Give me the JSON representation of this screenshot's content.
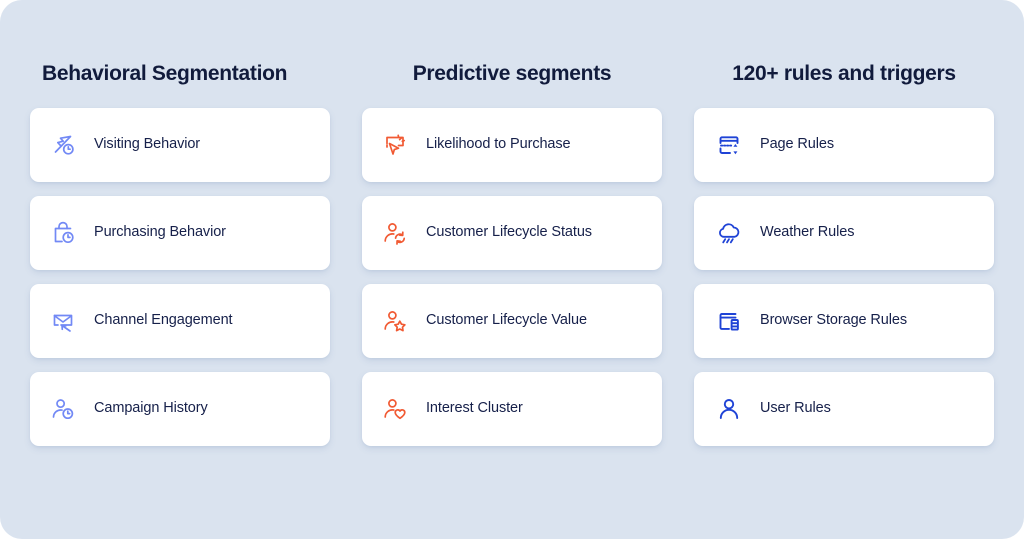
{
  "theme": {
    "background": "#dae3ef",
    "card_background": "#ffffff",
    "heading_color": "#111b3c",
    "label_color": "#16204a",
    "accent_periwinkle": "#7289f5",
    "accent_orange": "#f15a33",
    "accent_blue": "#1f43d6"
  },
  "columns": [
    {
      "title": "Behavioral Segmentation",
      "accent": "#7289f5",
      "items": [
        {
          "label": "Visiting Behavior",
          "icon": "cursor-clock-icon"
        },
        {
          "label": "Purchasing Behavior",
          "icon": "shopping-bag-clock-icon"
        },
        {
          "label": "Channel Engagement",
          "icon": "envelope-cursor-icon"
        },
        {
          "label": "Campaign History",
          "icon": "user-clock-icon"
        }
      ]
    },
    {
      "title": "Predictive segments",
      "accent": "#f15a33",
      "items": [
        {
          "label": "Likelihood to Purchase",
          "icon": "screen-cursor-click-icon"
        },
        {
          "label": "Customer Lifecycle Status",
          "icon": "user-refresh-icon"
        },
        {
          "label": "Customer Lifecycle Value",
          "icon": "user-star-icon"
        },
        {
          "label": "Interest Cluster",
          "icon": "user-heart-icon"
        }
      ]
    },
    {
      "title": "120+ rules and triggers",
      "accent": "#1f43d6",
      "items": [
        {
          "label": "Page Rules",
          "icon": "page-scroll-icon"
        },
        {
          "label": "Weather Rules",
          "icon": "cloud-rain-icon"
        },
        {
          "label": "Browser Storage Rules",
          "icon": "browser-storage-icon"
        },
        {
          "label": "User Rules",
          "icon": "user-icon"
        }
      ]
    }
  ]
}
